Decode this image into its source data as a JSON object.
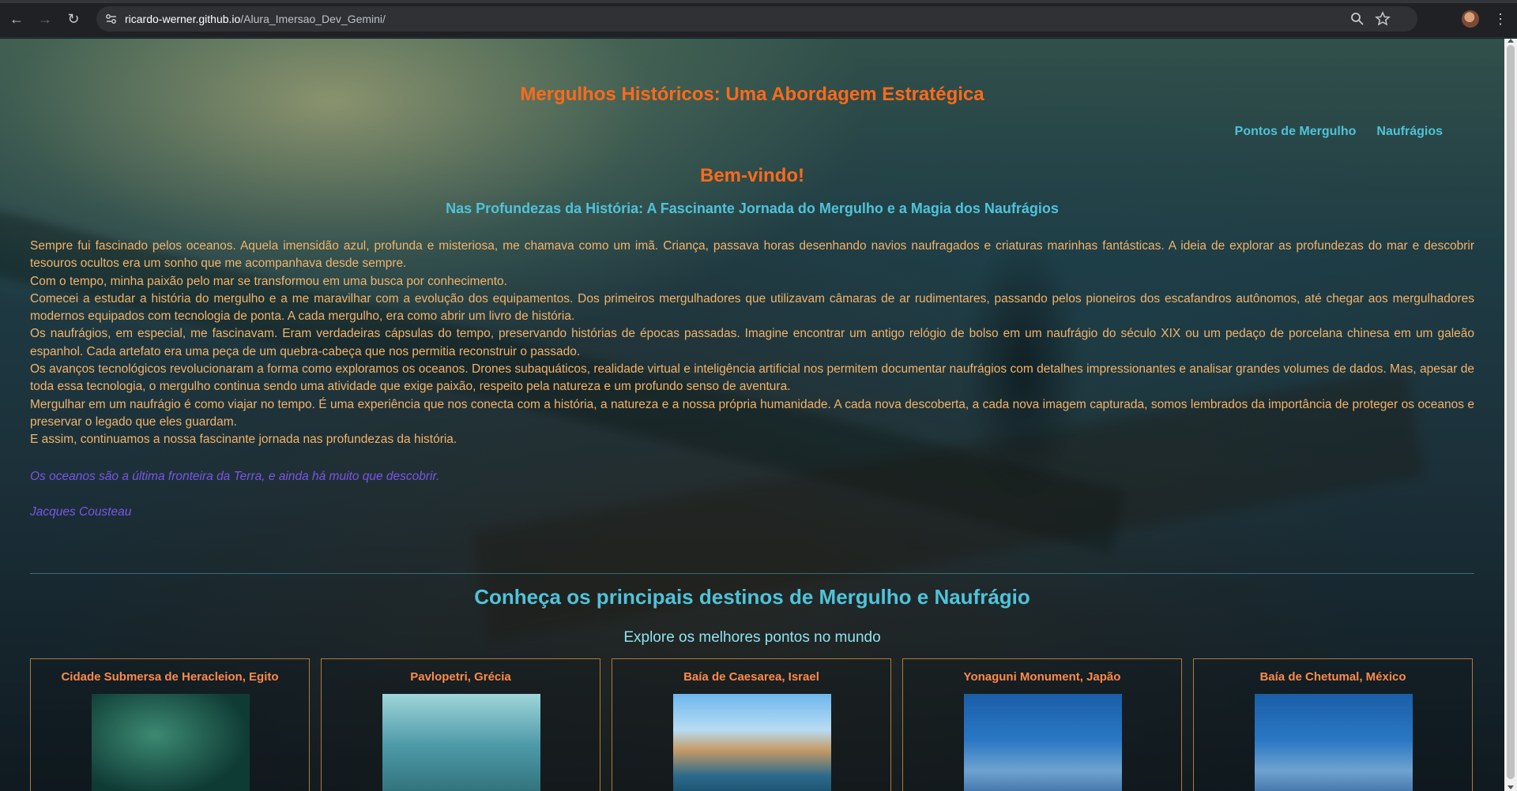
{
  "browser": {
    "url_host": "ricardo-werner.github.io",
    "url_path": "/Alura_Imersao_Dev_Gemini/",
    "back_icon": "←",
    "forward_icon": "→",
    "reload_icon": "↻",
    "menu_icon": "⋮"
  },
  "site": {
    "title": "Mergulhos Históricos: Uma Abordagem Estratégica",
    "nav": [
      "Pontos de Mergulho",
      "Naufrágios"
    ]
  },
  "intro": {
    "welcome": "Bem-vindo!",
    "subtitle": "Nas Profundezas da História: A Fascinante Jornada do Mergulho e a Magia dos Naufrágios",
    "paragraphs": [
      "Sempre fui fascinado pelos oceanos. Aquela imensidão azul, profunda e misteriosa, me chamava como um imã. Criança, passava horas desenhando navios naufragados e criaturas marinhas fantásticas. A ideia de explorar as profundezas do mar e descobrir tesouros ocultos era um sonho que me acompanhava desde sempre.",
      "Com o tempo, minha paixão pelo mar se transformou em uma busca por conhecimento.",
      "Comecei a estudar a história do mergulho e a me maravilhar com a evolução dos equipamentos. Dos primeiros mergulhadores que utilizavam câmaras de ar rudimentares, passando pelos pioneiros dos escafandros autônomos, até chegar aos mergulhadores modernos equipados com tecnologia de ponta. A cada mergulho, era como abrir um livro de história.",
      "Os naufrágios, em especial, me fascinavam. Eram verdadeiras cápsulas do tempo, preservando histórias de épocas passadas. Imagine encontrar um antigo relógio de bolso em um naufrágio do século XIX ou um pedaço de porcelana chinesa em um galeão espanhol. Cada artefato era uma peça de um quebra-cabeça que nos permitia reconstruir o passado.",
      "Os avanços tecnológicos revolucionaram a forma como exploramos os oceanos. Drones subaquáticos, realidade virtual e inteligência artificial nos permitem documentar naufrágios com detalhes impressionantes e analisar grandes volumes de dados. Mas, apesar de toda essa tecnologia, o mergulho continua sendo uma atividade que exige paixão, respeito pela natureza e um profundo senso de aventura.",
      "Mergulhar em um naufrágio é como viajar no tempo. É uma experiência que nos conecta com a história, a natureza e a nossa própria humanidade. A cada nova descoberta, a cada nova imagem capturada, somos lembrados da importância de proteger os oceanos e preservar o legado que eles guardam.",
      "E assim, continuamos a nossa fascinante jornada nas profundezas da história."
    ],
    "quote": "Os oceanos são a última fronteira da Terra, e ainda há muito que descobrir.",
    "author": "Jacques Cousteau"
  },
  "destinations": {
    "title": "Conheça os principais destinos de Mergulho e Naufrágio",
    "subtitle": "Explore os melhores pontos no mundo",
    "cards": [
      {
        "name": "Cidade Submersa de Heracleion, Egito"
      },
      {
        "name": "Pavlopetri, Grécia"
      },
      {
        "name": "Baía de Caesarea, Israel"
      },
      {
        "name": "Yonaguni Monument, Japão"
      },
      {
        "name": "Baía de Chetumal, México"
      }
    ]
  },
  "colors": {
    "title_orange": "#ff6a1a",
    "accent_cyan": "#4fc3d9",
    "text_amber": "#f2b36a",
    "quote_purple": "#7a56e8",
    "card_border": "#b07a3a"
  }
}
